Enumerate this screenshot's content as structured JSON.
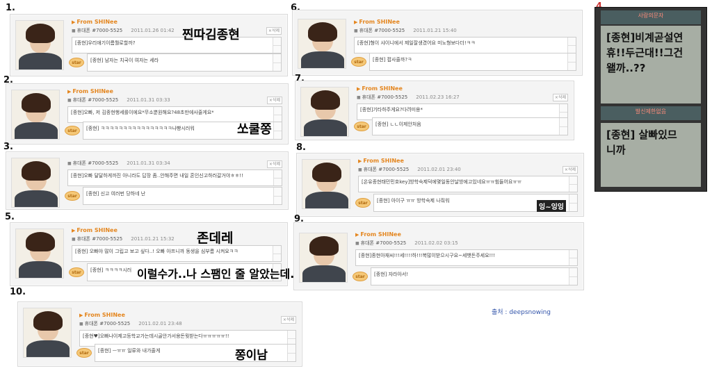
{
  "from_label": "From SHINee",
  "sender": "휴대폰 #7000-5525",
  "delete_label": "×삭제",
  "star_label": "star",
  "credit": "출처 : deepsnowing",
  "cards": [
    {
      "num": "1.",
      "date": "2011.01.26 01:42",
      "message": "[종현]우리애기이름뭘로할까?",
      "reply": "[종현] 남자는 치국이 여자는 세라",
      "annotation": "찐따김종현"
    },
    {
      "num": "2.",
      "date": "2011.01.31 03:33",
      "message": "[종현]오빠, 저 김종현행세를이에요*무소뿐원해요?48초만에사줄게요*",
      "reply": "[종현] ㅋㅋㅋㅋㅋㅋㅋㅋㅋㅋㅋㅋㅋㅋㅋㅋ나빵시러워",
      "annotation": "쏘쿨쫑"
    },
    {
      "num": "3.",
      "date": "2011.01.31 03:34",
      "message": "[종현]오빠 달달하게까진 아니라도 답장 좀..안해주면 내일 혼인신고하러갈거야ㅎㅎ!!",
      "reply": "[종현] 신고 여러번 당하네 난",
      "annotation": ""
    },
    {
      "num": "5.",
      "date": "2011.01.21 15:32",
      "message": "[종현] 오빠야 많이 그립고 보고 싶다..! 오빠 아프니까 동생을 심부름 시켜요ㅋㅋ",
      "reply": "[종현] ㅋㅋㅋㅋ시러",
      "annotation": "존데레",
      "annotation2": "이럴수가..나 스팸인 줄 알았는데.."
    },
    {
      "num": "10.",
      "date": "2011.02.01 23:48",
      "message": "[종현♥]오빠나이제고등학교가는데시골안가서용돈뭣받는다ㅠㅠㅠㅠㅠ!!",
      "reply": "[종현] ㅡㅠㅠ 일류와 내가줄게",
      "annotation": "쫑이남"
    },
    {
      "num": "6.",
      "date": "2011.01.21 15:40",
      "message": "[종현]형이 샤이니에서 제일잘생겼어요 미노형보다더!ㅋㅋ",
      "reply": "[종현] 팝사줄까?ㅋ",
      "annotation": ""
    },
    {
      "num": "7.",
      "date": "2011.02.23 16:27",
      "message": "[종현]기타하주게요?다려미용*",
      "reply": "[종현] ㄴㄴ이제안처음",
      "annotation": ""
    },
    {
      "num": "8.",
      "date": "2011.02.01 23:40",
      "message": "[온유종현태민민호key]방학숙제덕에몇일동안날방에고있네요ㅠㅠ힘들어요ㅠㅠ",
      "reply": "[종현] 아이구 ㅠㅠ 방학숙제 나줘워",
      "annotation": "잉~잉잉"
    },
    {
      "num": "9.",
      "date": "2011.02.02 03:15",
      "message": "[종현]종현아재씨!!!세!!!!하!!!복많이받으시구요~세뱃돈주세요!!!",
      "reply": "[종현] 자라아서!",
      "annotation": ""
    }
  ],
  "phone": {
    "num": "4.",
    "header1": "사랑의문자",
    "screen1": "[종현]비계곧설연\n휴!!두근대!!그건\n왤까..??",
    "header2": "발신제한없음",
    "screen2": "[종현] 살빠있므\n니까"
  }
}
